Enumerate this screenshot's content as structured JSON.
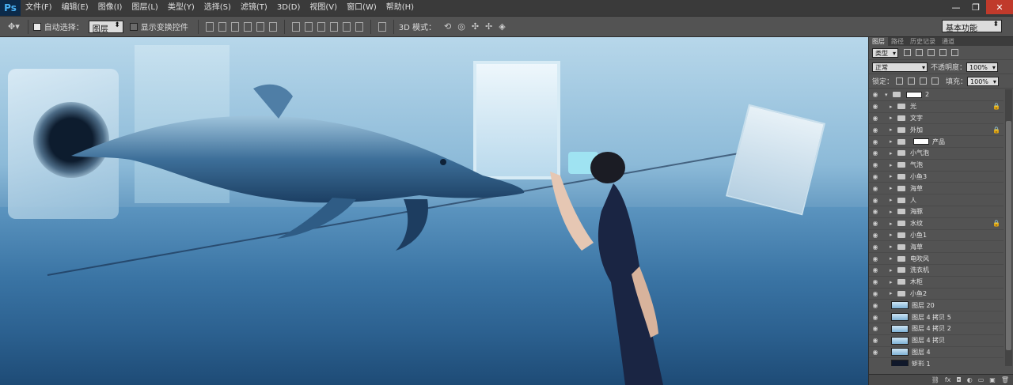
{
  "app": {
    "logo": "Ps"
  },
  "menu": [
    "文件(F)",
    "编辑(E)",
    "图像(I)",
    "图层(L)",
    "类型(Y)",
    "选择(S)",
    "滤镜(T)",
    "3D(D)",
    "视图(V)",
    "窗口(W)",
    "帮助(H)"
  ],
  "window_controls": {
    "minimize": "—",
    "restore": "❐",
    "close": "✕"
  },
  "options": {
    "auto_select_label": "自动选择：",
    "auto_select_value": "图层",
    "show_transform_label": "显示变换控件",
    "mode_3d_label": "3D 模式：",
    "workspace": "基本功能"
  },
  "panel": {
    "tabs": [
      "图层",
      "路径",
      "历史记录",
      "通道"
    ],
    "filter_kind": "类型",
    "blend_mode": "正常",
    "opacity_label": "不透明度：",
    "opacity_value": "100%",
    "lock_label": "锁定：",
    "fill_label": "填充：",
    "fill_value": "100%"
  },
  "layers": [
    {
      "name": "2",
      "type": "group-top",
      "visible": true
    },
    {
      "name": "光",
      "type": "folder",
      "visible": true,
      "locked": true
    },
    {
      "name": "文字",
      "type": "folder",
      "visible": true
    },
    {
      "name": "外加",
      "type": "folder",
      "visible": true,
      "locked": true
    },
    {
      "name": "产品",
      "type": "folder-mask",
      "visible": true
    },
    {
      "name": "小气泡",
      "type": "folder",
      "visible": true
    },
    {
      "name": "气泡",
      "type": "folder",
      "visible": true
    },
    {
      "name": "小鱼3",
      "type": "folder",
      "visible": true
    },
    {
      "name": "海草",
      "type": "folder",
      "visible": true
    },
    {
      "name": "人",
      "type": "folder",
      "visible": true
    },
    {
      "name": "海豚",
      "type": "folder",
      "visible": true
    },
    {
      "name": "水纹",
      "type": "folder",
      "visible": true,
      "locked": true
    },
    {
      "name": "小鱼1",
      "type": "folder",
      "visible": true
    },
    {
      "name": "海草",
      "type": "folder",
      "visible": true
    },
    {
      "name": "电吹风",
      "type": "folder",
      "visible": true
    },
    {
      "name": "洗衣机",
      "type": "folder",
      "visible": true
    },
    {
      "name": "木柜",
      "type": "folder",
      "visible": true
    },
    {
      "name": "小鱼2",
      "type": "folder",
      "visible": true
    },
    {
      "name": "图层 20",
      "type": "image",
      "visible": true
    },
    {
      "name": "图层 4 拷贝 5",
      "type": "image",
      "visible": true
    },
    {
      "name": "图层 4 拷贝 2",
      "type": "image",
      "visible": true
    },
    {
      "name": "图层 4 拷贝",
      "type": "image",
      "visible": true
    },
    {
      "name": "图层 4",
      "type": "image",
      "visible": true
    },
    {
      "name": "矩形 1",
      "type": "shape",
      "visible": false
    }
  ],
  "footer_icons": [
    "link-icon",
    "fx-icon",
    "mask-icon",
    "adjustment-icon",
    "folder-icon",
    "new-layer-icon",
    "trash-icon"
  ]
}
